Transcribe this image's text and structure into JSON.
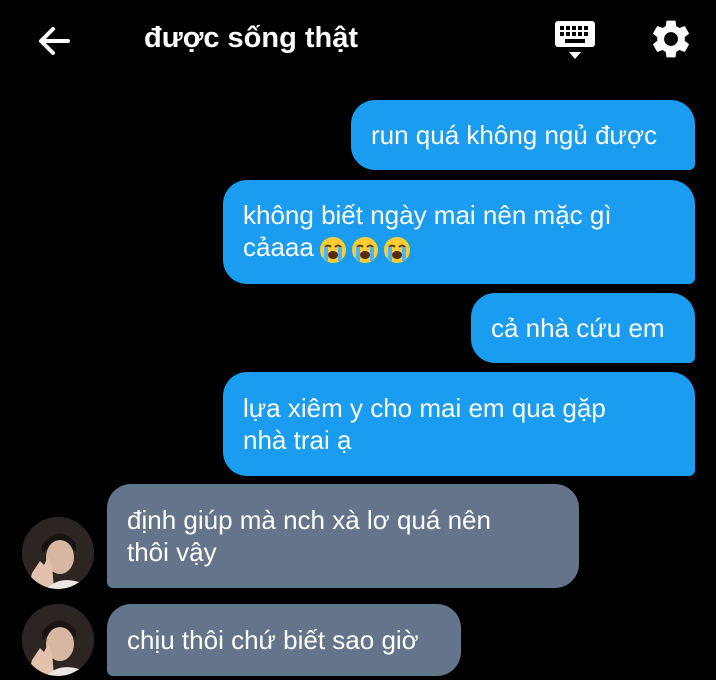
{
  "header": {
    "title": "được sống thật",
    "back_icon": "arrow-left-icon",
    "keyboard_icon": "keyboard-icon",
    "settings_icon": "gear-icon"
  },
  "messages": [
    {
      "direction": "outgoing",
      "text": "run quá không ngủ được"
    },
    {
      "direction": "outgoing",
      "text": "không biết ngày mai nên mặc gì\ncảaaa",
      "emoji": [
        "loudly-crying-face",
        "loudly-crying-face",
        "loudly-crying-face"
      ]
    },
    {
      "direction": "outgoing",
      "text": "cả nhà cứu em"
    },
    {
      "direction": "outgoing",
      "text": "lựa xiêm y cho mai em qua gặp\nnhà trai ạ"
    },
    {
      "direction": "incoming",
      "text": "định giúp mà nch xà lơ quá nên\nthôi vậy"
    },
    {
      "direction": "incoming",
      "text": "chịu thôi chứ biết sao giờ"
    }
  ],
  "colors": {
    "background": "#000000",
    "outgoing_bubble": "#1a9cf0",
    "incoming_bubble": "#64748a",
    "text": "#ffffff"
  }
}
